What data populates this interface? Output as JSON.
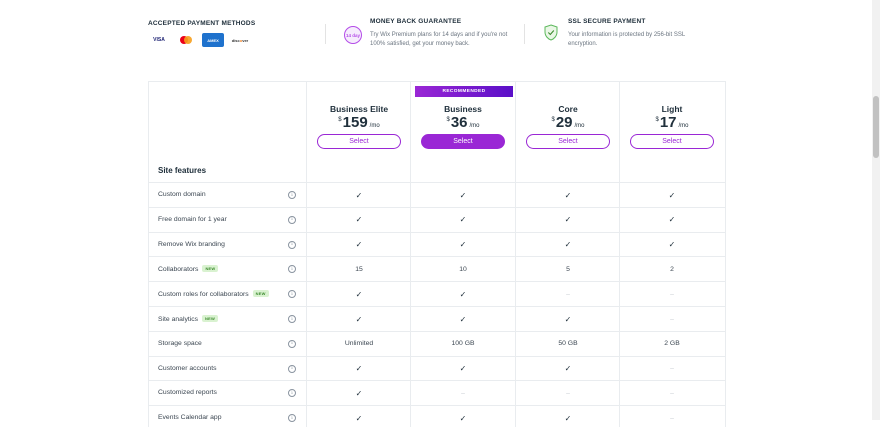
{
  "payment": {
    "title": "ACCEPTED PAYMENT METHODS",
    "cards": [
      {
        "name": "visa",
        "label": "VISA"
      },
      {
        "name": "mastercard",
        "label": ""
      },
      {
        "name": "amex",
        "label": "AMERICAN EXPRESS"
      },
      {
        "name": "discover",
        "label": "DISCOVER"
      }
    ]
  },
  "guarantee": {
    "badge": "14 day",
    "title": "MONEY BACK GUARANTEE",
    "desc": "Try Wix Premium plans for 14 days and if you're not 100% satisfied, get your money back."
  },
  "ssl": {
    "title": "SSL SECURE PAYMENT",
    "desc": "Your information is protected by 256-bit SSL encryption."
  },
  "recommended_label": "RECOMMENDED",
  "plans": [
    {
      "name": "Business Elite",
      "currency": "$",
      "price": "159",
      "period": "/mo",
      "select": "Select",
      "recommended": false
    },
    {
      "name": "Business",
      "currency": "$",
      "price": "36",
      "period": "/mo",
      "select": "Select",
      "recommended": true
    },
    {
      "name": "Core",
      "currency": "$",
      "price": "29",
      "period": "/mo",
      "select": "Select",
      "recommended": false
    },
    {
      "name": "Light",
      "currency": "$",
      "price": "17",
      "period": "/mo",
      "select": "Select",
      "recommended": false
    }
  ],
  "section_title": "Site features",
  "rows": [
    {
      "label": "Custom domain",
      "new": false,
      "values": [
        "✓",
        "✓",
        "✓",
        "✓"
      ]
    },
    {
      "label": "Free domain for 1 year",
      "new": false,
      "values": [
        "✓",
        "✓",
        "✓",
        "✓"
      ]
    },
    {
      "label": "Remove Wix branding",
      "new": false,
      "values": [
        "✓",
        "✓",
        "✓",
        "✓"
      ]
    },
    {
      "label": "Collaborators",
      "new": true,
      "values": [
        "15",
        "10",
        "5",
        "2"
      ]
    },
    {
      "label": "Custom roles for collaborators",
      "new": true,
      "values": [
        "✓",
        "✓",
        "–",
        "–"
      ]
    },
    {
      "label": "Site analytics",
      "new": true,
      "values": [
        "✓",
        "✓",
        "✓",
        "–"
      ]
    },
    {
      "label": "Storage space",
      "new": false,
      "values": [
        "Unlimited",
        "100 GB",
        "50 GB",
        "2 GB"
      ]
    },
    {
      "label": "Customer accounts",
      "new": false,
      "values": [
        "✓",
        "✓",
        "✓",
        "–"
      ]
    },
    {
      "label": "Customized reports",
      "new": false,
      "values": [
        "✓",
        "–",
        "–",
        "–"
      ]
    },
    {
      "label": "Events Calendar app",
      "new": false,
      "values": [
        "✓",
        "✓",
        "✓",
        "–"
      ]
    }
  ],
  "new_badge": "NEW",
  "info_glyph": "i"
}
